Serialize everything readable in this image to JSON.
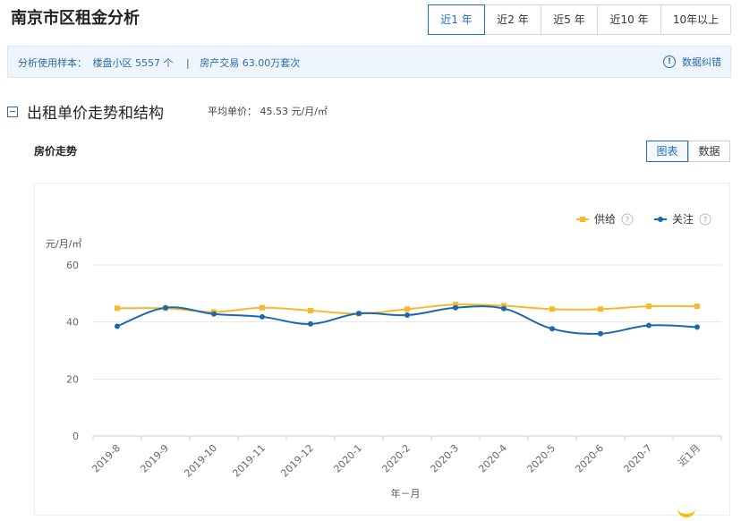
{
  "header": {
    "title": "南京市区租金分析"
  },
  "range_tabs": [
    {
      "label": "近1 年",
      "active": true
    },
    {
      "label": "近2 年",
      "active": false
    },
    {
      "label": "近5 年",
      "active": false
    },
    {
      "label": "近10 年",
      "active": false
    },
    {
      "label": "10年以上",
      "active": false
    }
  ],
  "info": {
    "text1": "分析使用样本：",
    "text2": "楼盘小区 5557 个",
    "sep": "|",
    "text3": "房产交易 63.00万套次",
    "report_label": "数据纠错"
  },
  "section": {
    "title": "出租单价走势和结构",
    "avg_text": "平均单价： 45.53 元/月/㎡"
  },
  "subsection": {
    "title": "房价走势"
  },
  "view_tabs": [
    {
      "label": "图表",
      "active": true
    },
    {
      "label": "数据",
      "active": false
    }
  ],
  "colors": {
    "supply": "#f5b82e",
    "attention": "#1a68b0",
    "accent": "#1f6fc5"
  },
  "chart_data": {
    "type": "line",
    "ylabel": "元/月/㎡",
    "xlabel": "年－月",
    "categories": [
      "2019-8",
      "2019-9",
      "2019-10",
      "2019-11",
      "2019-12",
      "2020-1",
      "2020-2",
      "2020-3",
      "2020-4",
      "2020-5",
      "2020-6",
      "2020-7",
      "近1月"
    ],
    "ylim": [
      0,
      60
    ],
    "yticks": [
      0,
      20,
      40,
      60
    ],
    "grid": true,
    "legend_position": "top-right",
    "series": [
      {
        "name": "供给",
        "color": "#f5b82e",
        "marker": "square",
        "values": [
          44.8,
          44.8,
          43.5,
          45.0,
          44.0,
          42.9,
          44.5,
          46.1,
          45.7,
          44.5,
          44.5,
          45.5,
          45.5
        ]
      },
      {
        "name": "关注",
        "color": "#1a68b0",
        "marker": "circle",
        "values": [
          38.5,
          45.0,
          42.8,
          41.8,
          39.3,
          43.0,
          42.4,
          45.0,
          44.7,
          37.6,
          35.9,
          38.8,
          38.2
        ]
      }
    ]
  }
}
